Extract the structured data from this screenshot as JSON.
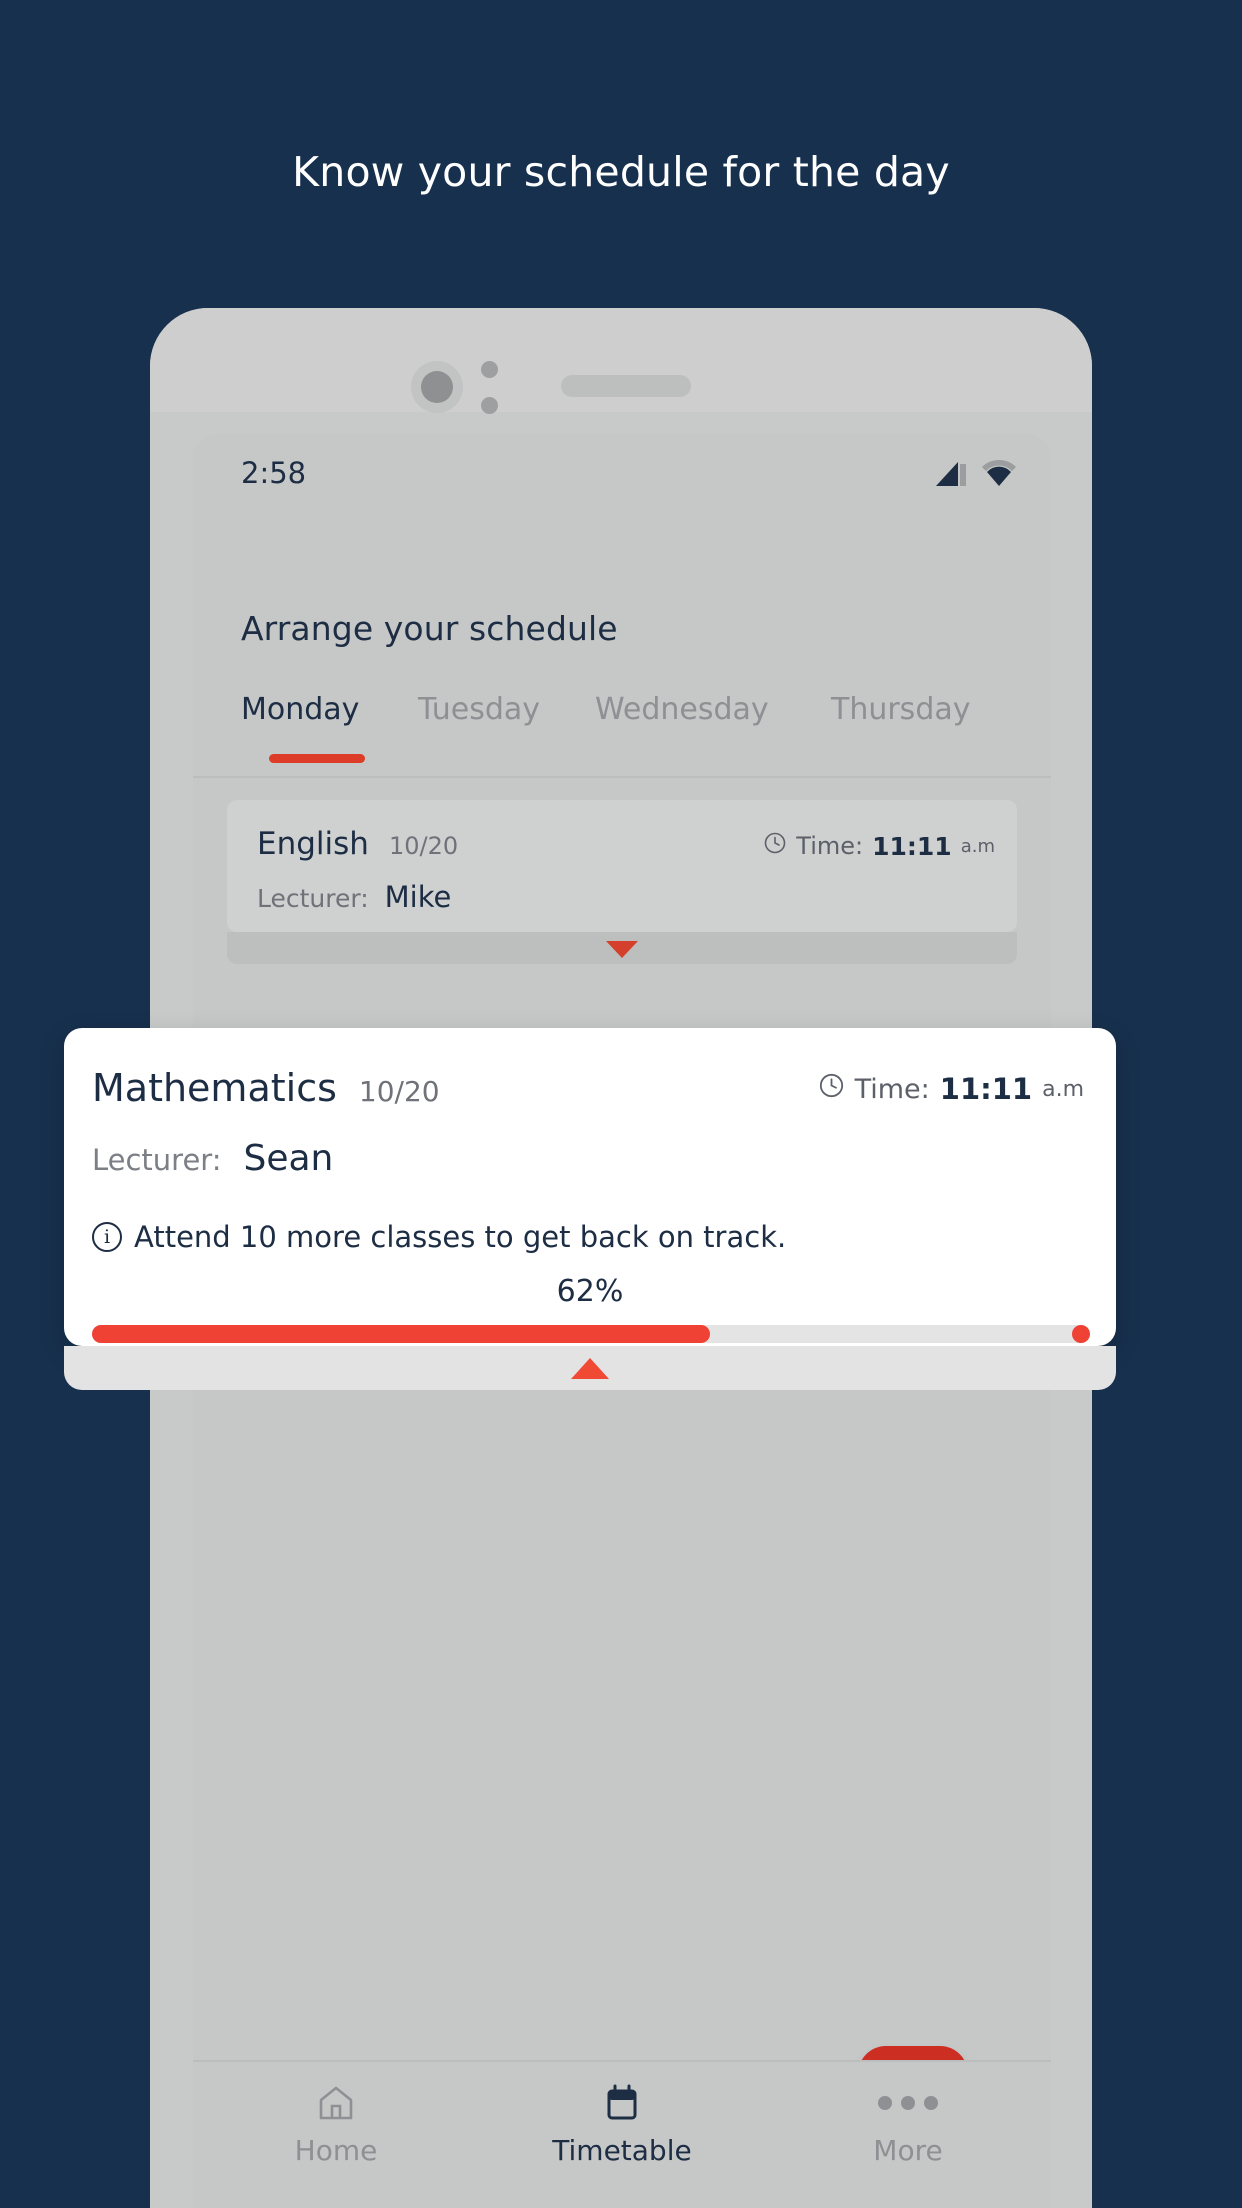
{
  "theme": {
    "background": "#17304d",
    "accent_red": "#dc3c28",
    "navy_text": "#1d2d44",
    "muted_text": "#8e9094",
    "phone_body": "#c8c9c9"
  },
  "headline": "Know your schedule for the day",
  "phone": {
    "status_bar": {
      "time": "2:58",
      "icons": [
        "signal-icon",
        "wifi-icon"
      ]
    },
    "screen_title": "Arrange your schedule",
    "tabs": [
      {
        "label": "Monday",
        "active": true
      },
      {
        "label": "Tuesday",
        "active": false
      },
      {
        "label": "Wednesday",
        "active": false
      },
      {
        "label": "Thursday",
        "active": false
      }
    ],
    "class_card": {
      "subject": "English",
      "date": "10/20",
      "time_label": "Time:",
      "time_value": "11:11",
      "time_ampm": "a.m",
      "lecturer_label": "Lecturer:",
      "lecturer_name": "Mike",
      "expand_icon": "triangle-down-icon"
    },
    "fab": {
      "icon": "plus-icon",
      "color": "#cc2e22"
    },
    "bottom_nav": [
      {
        "label": "Home",
        "icon": "home-icon",
        "active": false
      },
      {
        "label": "Timetable",
        "icon": "calendar-icon",
        "active": true
      },
      {
        "label": "More",
        "icon": "more-dots-icon",
        "active": false
      }
    ]
  },
  "overlay_card": {
    "subject": "Mathematics",
    "date": "10/20",
    "time_label": "Time:",
    "time_value": "11:11",
    "time_ampm": "a.m",
    "lecturer_label": "Lecturer:",
    "lecturer_name": "Sean",
    "note_icon": "info-icon",
    "note": "Attend 10 more classes to get back on track.",
    "percent_label": "62%",
    "percent_value": 62,
    "collapse_icon": "triangle-up-icon"
  }
}
